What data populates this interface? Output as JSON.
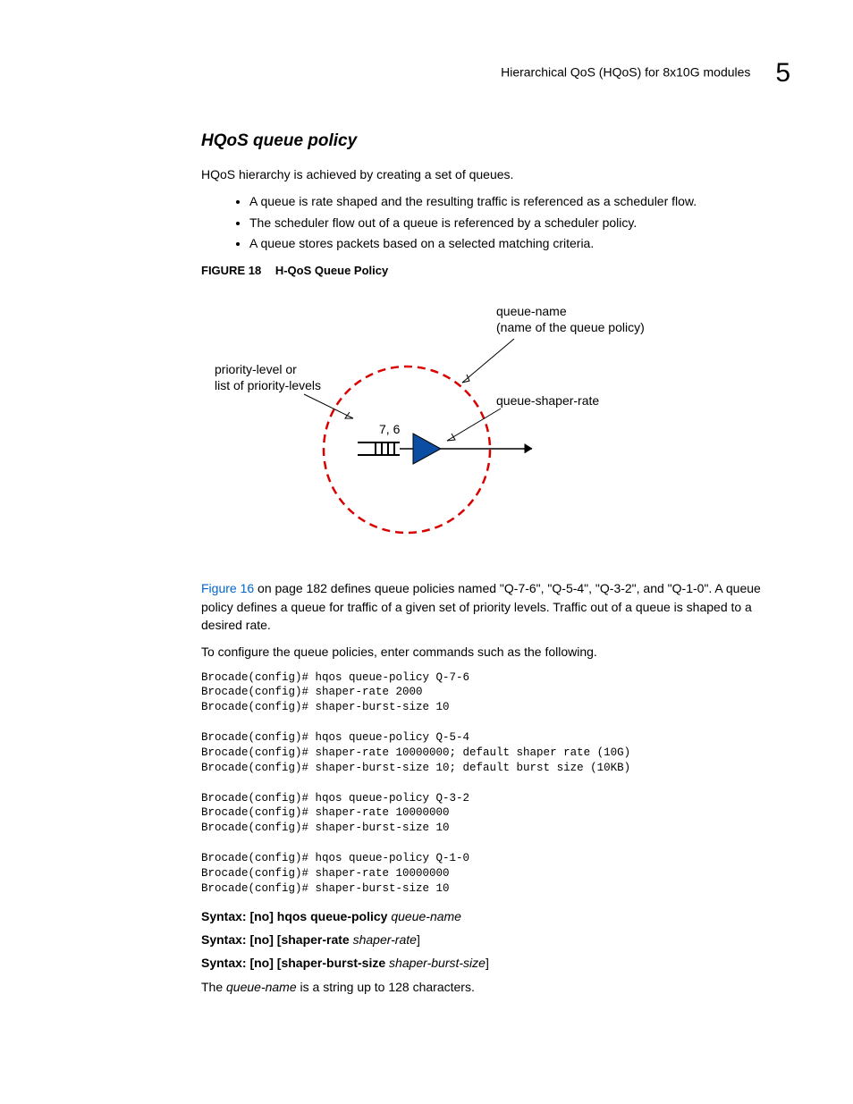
{
  "header": {
    "title": "Hierarchical QoS (HQoS) for 8x10G modules",
    "page_num": "5"
  },
  "section": {
    "title": "HQoS queue policy",
    "intro": "HQoS hierarchy is achieved by creating a set of queues.",
    "bullets": [
      "A queue is rate shaped and the resulting traffic is referenced as a scheduler flow.",
      "The scheduler flow out of a queue is referenced by a scheduler policy.",
      "A queue stores packets based on a selected matching criteria."
    ]
  },
  "figure": {
    "label": "FIGURE 18",
    "title": "H-QoS Queue Policy",
    "labels": {
      "queue_name_line1": "queue-name",
      "queue_name_line2": "(name of the queue policy)",
      "priority_line1": "priority-level or",
      "priority_line2": "list of priority-levels",
      "shaper": "queue-shaper-rate",
      "center": "7, 6"
    }
  },
  "para_after_fig": {
    "link": "Figure 16",
    "rest": " on page 182 defines queue policies named \"Q-7-6\", \"Q-5-4\", \"Q-3-2\", and \"Q-1-0\". A queue policy defines a queue for traffic of a given set of priority levels. Traffic out of a queue is shaped to a desired rate."
  },
  "config_intro": "To configure the queue policies, enter commands such as the following.",
  "code": "Brocade(config)# hqos queue-policy Q-7-6\nBrocade(config)# shaper-rate 2000\nBrocade(config)# shaper-burst-size 10\n\nBrocade(config)# hqos queue-policy Q-5-4\nBrocade(config)# shaper-rate 10000000; default shaper rate (10G)\nBrocade(config)# shaper-burst-size 10; default burst size (10KB)\n\nBrocade(config)# hqos queue-policy Q-3-2\nBrocade(config)# shaper-rate 10000000\nBrocade(config)# shaper-burst-size 10\n\nBrocade(config)# hqos queue-policy Q-1-0\nBrocade(config)# shaper-rate 10000000\nBrocade(config)# shaper-burst-size 10",
  "syntax": {
    "s1_bold": "Syntax:  [no] hqos queue-policy ",
    "s1_ital": "queue-name",
    "s2_bold": "Syntax:  [no] [shaper-rate ",
    "s2_ital": "shaper-rate",
    "s2_close": "]",
    "s3_bold": "Syntax:  [no] [shaper-burst-size ",
    "s3_ital": "shaper-burst-size",
    "s3_close": "]"
  },
  "footer_para_pre": "The ",
  "footer_para_ital": "queue-name",
  "footer_para_post": " is a string up to 128 characters."
}
